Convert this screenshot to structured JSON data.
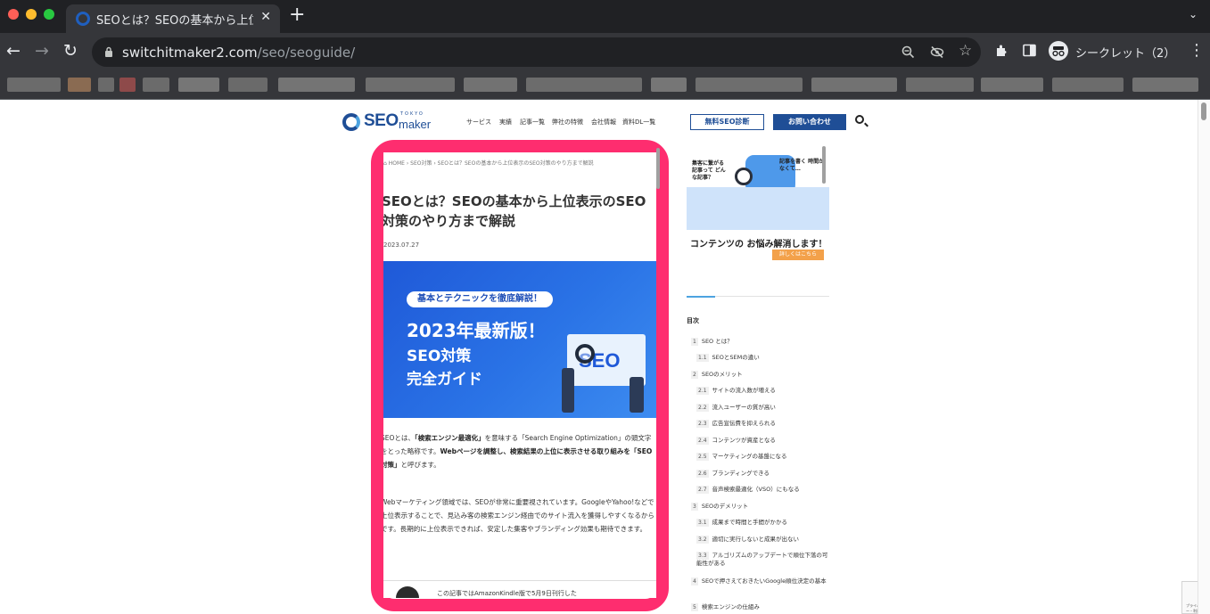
{
  "browser": {
    "tab_title": "SEOとは？SEOの基本から上位表示",
    "new_tab": "+",
    "close": "✕",
    "tab_list": "⌄",
    "url_host": "switchitmaker2.com",
    "url_path": "/seo/seoguide/",
    "incognito_label": "シークレット（2）",
    "icons": [
      "back-icon",
      "forward-icon",
      "reload-icon",
      "lock-icon",
      "zoom-icon",
      "tracking-off-icon",
      "star-icon",
      "extensions-icon",
      "sidepanel-icon",
      "incognito-icon",
      "menu-icon"
    ],
    "traffic_colors": [
      "#ff5f57",
      "#febc2e",
      "#28c840"
    ]
  },
  "site": {
    "logo_main": "SEO",
    "logo_sub": "maker",
    "logo_tokyo": "TOKYO",
    "nav": [
      "サービス",
      "実績",
      "記事一覧",
      "弊社の特徴",
      "会社情報",
      "資料DL一覧"
    ],
    "btn_diagnosis": "無料SEO診断",
    "btn_contact": "お問い合わせ",
    "brand_color": "#1f4e96",
    "highlight_color": "#fe2d6f"
  },
  "article": {
    "breadcrumb": "⌂ HOME  ›  SEO対策  ›  SEOとは？SEOの基本から上位表示のSEO対策のやり方まで解説",
    "title": "SEOとは？SEOの基本から上位表示のSEO対策のやり方まで解説",
    "date": "2023.07.27",
    "hero_pill": "基本とテクニックを徹底解説！",
    "hero_line1": "2023年最新版！",
    "hero_line2": "SEO対策",
    "hero_line3": "完全ガイド",
    "hero_seo": "SEO",
    "para1_a": "SEOとは、",
    "para1_b": "「検索エンジン最適化」",
    "para1_c": "を意味する「Search Engine Optimization」の頭文字をとった略称です。",
    "para1_d": "Webページを調整し、検索結果の上位に表示させる取り組みを「SEO対策」",
    "para1_e": "と呼びます。",
    "para2": "Webマーケティング領域では、SEOが非常に重要視されています。GoogleやYahoo!などで上位表示することで、見込み客の検索エンジン経由でのサイト流入を獲得しやすくなるからです。長期的に上位表示できれば、安定した集客やブランディング効果も期待できます。",
    "kindle": "この記事ではAmazonKindle版で5月9日刊行した"
  },
  "sidebar": {
    "banner_q1": "集客に繋がる記事って どんな記事？",
    "banner_q2": "記事を書く 時間がなくて…",
    "banner_main": "コンテンツの お悩み解消します！",
    "banner_btn": "詳しくはこちら",
    "toc_title": "目次",
    "toc": [
      {
        "num": "1",
        "label": "SEO とは？",
        "level": 1
      },
      {
        "num": "1.1",
        "label": "SEOとSEMの違い",
        "level": 2
      },
      {
        "num": "2",
        "label": "SEOのメリット",
        "level": 1
      },
      {
        "num": "2.1",
        "label": "サイトの流入数が増える",
        "level": 2
      },
      {
        "num": "2.2",
        "label": "流入ユーザーの質が高い",
        "level": 2
      },
      {
        "num": "2.3",
        "label": "広告宣伝費を抑えられる",
        "level": 2
      },
      {
        "num": "2.4",
        "label": "コンテンツが資産となる",
        "level": 2
      },
      {
        "num": "2.5",
        "label": "マーケティングの基盤になる",
        "level": 2
      },
      {
        "num": "2.6",
        "label": "ブランディングできる",
        "level": 2
      },
      {
        "num": "2.7",
        "label": "音声検索最適化（VSO）にもなる",
        "level": 2
      },
      {
        "num": "3",
        "label": "SEOのデメリット",
        "level": 1
      },
      {
        "num": "3.1",
        "label": "成果まで時間と手間がかかる",
        "level": 2
      },
      {
        "num": "3.2",
        "label": "適切に実行しないと成果が出ない",
        "level": 2
      },
      {
        "num": "3.3",
        "label": "アルゴリズムのアップデートで順位下落の可能性がある",
        "level": 2
      },
      {
        "num": "4",
        "label": "SEOで押さえておきたいGoogle順位決定の基本",
        "level": 1
      },
      {
        "num": "5",
        "label": "検索エンジンの仕組み",
        "level": 1
      }
    ]
  },
  "recaptcha": "プライバシー・利用規約"
}
